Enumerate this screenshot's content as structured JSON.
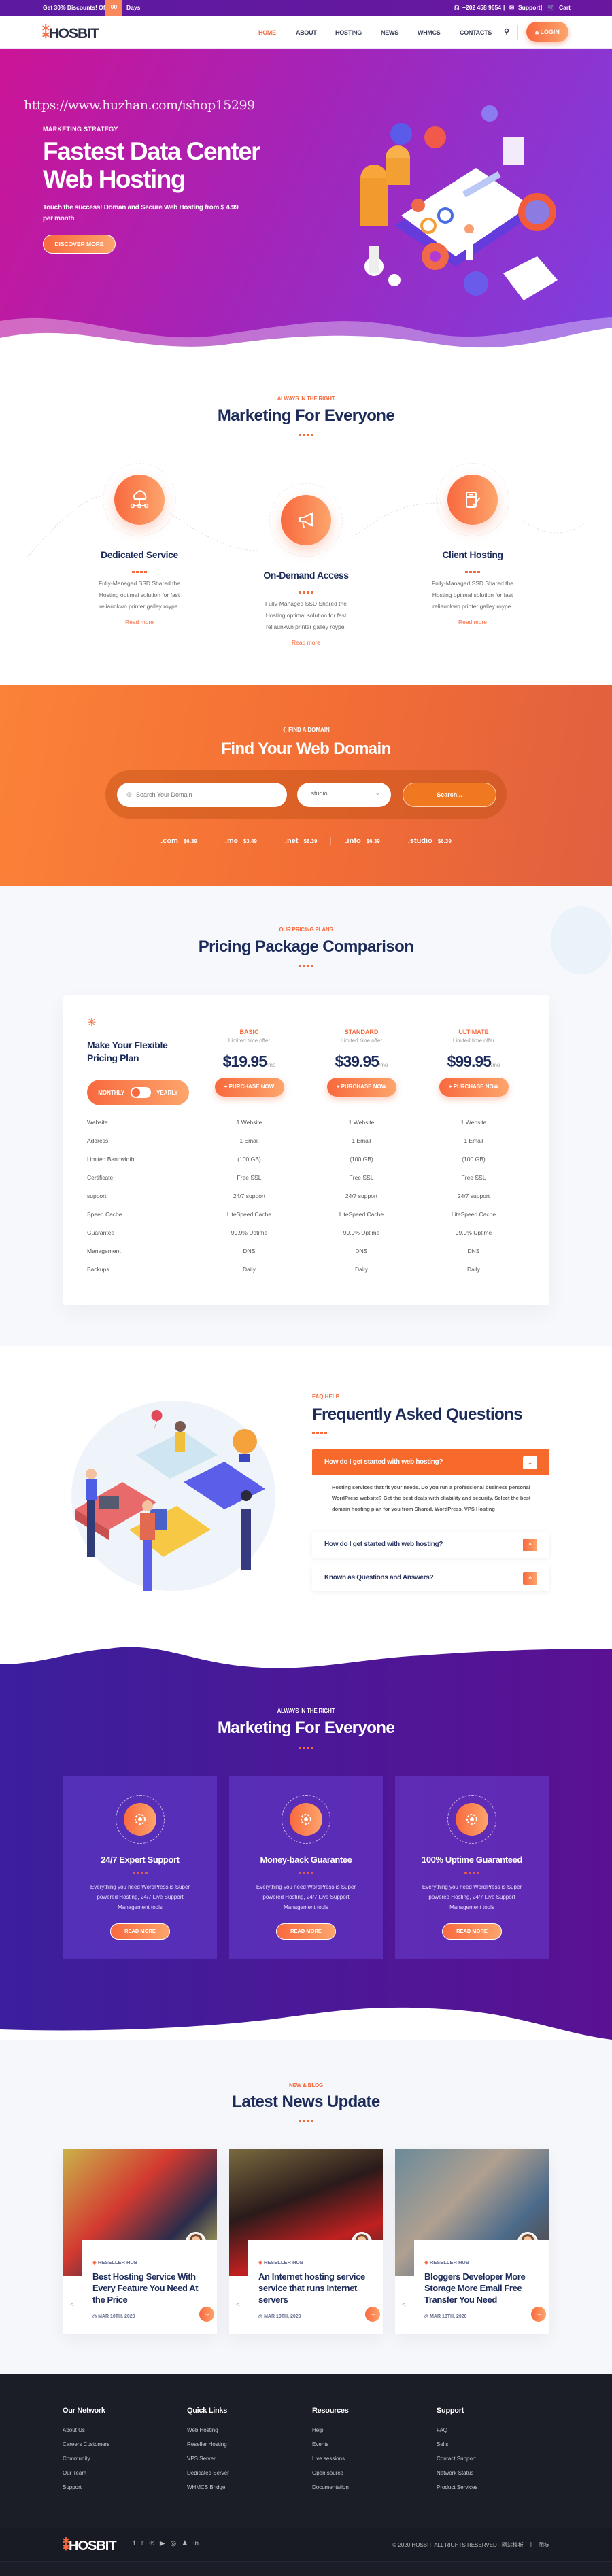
{
  "topbar": {
    "offer": "Get 30% Discounts! Offer",
    "days_count": "00",
    "days_label": "Days",
    "phone": "+202 458 9654",
    "support": "Support",
    "cart": "Cart",
    "separator": "|"
  },
  "header": {
    "logo": "HOSBIT",
    "nav": [
      {
        "label": "HOME",
        "active": true
      },
      {
        "label": "ABOUT"
      },
      {
        "label": "HOSTING"
      },
      {
        "label": "NEWS"
      },
      {
        "label": "WHMCS"
      },
      {
        "label": "CONTACTS"
      }
    ],
    "login": "LOGIN"
  },
  "hero": {
    "watermark": "https://www.huzhan.com/ishop15299",
    "eyebrow": "MARKETING STRATEGY",
    "title_line1": "Fastest Data Center",
    "title_line2": "Web Hosting",
    "subtitle": "Touch the success! Doman and Secure Web Hosting from $ 4.99 per month",
    "cta": "DISCOVER MORE"
  },
  "services": {
    "eyebrow": "ALWAYS IN THE RIGHT",
    "title": "Marketing For Everyone",
    "items": [
      {
        "title": "Dedicated Service",
        "desc": "Fully-Managed SSD Shared the Hosting optimal solution for fast reliaunkwn printer galley roype.",
        "link": "Read more",
        "icon": "cloud-network-icon"
      },
      {
        "title": "On-Demand Access",
        "desc": "Fully-Managed SSD Shared the Hosting optimal solution for fast reliaunkwn printer galley roype.",
        "link": "Read more",
        "icon": "megaphone-icon"
      },
      {
        "title": "Client Hosting",
        "desc": "Fully-Managed SSD Shared the Hosting optimal solution for fast reliaunkwn printer galley roype.",
        "link": "Read more",
        "icon": "server-edit-icon"
      }
    ]
  },
  "domain": {
    "eyebrow": "FIND A DOMAIN",
    "title": "Find Your Web Domain",
    "placeholder": "Search Your Domain",
    "selected_tld": ".studio",
    "search_button": "Search...",
    "tlds": [
      {
        "ext": ".com",
        "price": "$6.39"
      },
      {
        "ext": ".me",
        "price": "$3.49"
      },
      {
        "ext": ".net",
        "price": "$8.39"
      },
      {
        "ext": ".info",
        "price": "$6.39"
      },
      {
        "ext": ".studio",
        "price": "$6.39"
      }
    ]
  },
  "pricing": {
    "eyebrow": "OUR PRICING PLANS",
    "title": "Pricing Package Comparison",
    "intro_line1": "Make Your Flexible",
    "intro_line2": "Pricing Plan",
    "toggle_monthly": "MONTHLY",
    "toggle_yearly": "YEARLY",
    "plans": [
      {
        "name": "BASIC",
        "offer": "Limited time offer",
        "price": "$19.95",
        "per": "/mo",
        "button": "+ PURCHASE NOW"
      },
      {
        "name": "STANDARD",
        "offer": "Limited time offer",
        "price": "$39.95",
        "per": "/mo",
        "button": "+ PURCHASE NOW"
      },
      {
        "name": "ULTIMATE",
        "offer": "Limited time offer",
        "price": "$99.95",
        "per": "/mo",
        "button": "+ PURCHASE NOW"
      }
    ],
    "rows": [
      {
        "label": "Website",
        "values": [
          "1 Website",
          "1 Website",
          "1 Website"
        ]
      },
      {
        "label": "Address",
        "values": [
          "1 Email",
          "1 Email",
          "1 Email"
        ]
      },
      {
        "label": "Limited Bandwidth",
        "values": [
          "(100 GB)",
          "(100 GB)",
          "(100 GB)"
        ]
      },
      {
        "label": "Certificate",
        "values": [
          "Free SSL",
          "Free SSL",
          "Free SSL"
        ]
      },
      {
        "label": "support",
        "values": [
          "24/7 support",
          "24/7 support",
          "24/7 support"
        ]
      },
      {
        "label": "Speed Cache",
        "values": [
          "LiteSpeed Cache",
          "LiteSpeed Cache",
          "LiteSpeed Cache"
        ]
      },
      {
        "label": "Guarantee",
        "values": [
          "99.9% Uptime",
          "99.9% Uptime",
          "99.9% Uptime"
        ]
      },
      {
        "label": "Management",
        "values": [
          "DNS",
          "DNS",
          "DNS"
        ]
      },
      {
        "label": "Backups",
        "values": [
          "Daily",
          "Daily",
          "Daily"
        ]
      }
    ]
  },
  "faq": {
    "eyebrow": "FAQ HELP",
    "title": "Frequently Asked Questions",
    "items": [
      {
        "question": "How do I get started with web hosting?",
        "answer": "Hosting services that fit your needs. Do you run a professional business personal WordPress website? Get the best deals with eliability and security. Select the best domain hosting plan for you from Shared, WordPress, VPS Hosting",
        "open": true
      },
      {
        "question": "How do I get started with web hosting?",
        "open": false
      },
      {
        "question": "Known as Questions and Answers?",
        "open": false
      }
    ]
  },
  "features": {
    "eyebrow": "ALWAYS IN THE RIGHT",
    "title": "Marketing For Everyone",
    "items": [
      {
        "title": "24/7 Expert Support",
        "desc": "Everything you need WordPress is Super powered Hosting, 24/7 Live Support Management tools",
        "button": "READ MORE",
        "icon": "gear-wrench-icon"
      },
      {
        "title": "Money-back Guarantee",
        "desc": "Everything you need WordPress is Super powered Hosting, 24/7 Live Support Management tools",
        "button": "READ MORE",
        "icon": "money-bag-icon"
      },
      {
        "title": "100% Uptime Guaranteed",
        "desc": "Everything you need WordPress is Super powered Hosting, 24/7 Live Support Management tools",
        "button": "READ MORE",
        "icon": "cloud-server-icon"
      }
    ]
  },
  "news": {
    "eyebrow": "NEW & BLOG",
    "title": "Latest News Update",
    "posts": [
      {
        "category": "RESELLER HUB",
        "title": "Best Hosting Service With Every Feature You Need At the Price",
        "date": "MAR 10TH, 2020"
      },
      {
        "category": "RESELLER HUB",
        "title": "An Internet hosting service service that runs Internet servers",
        "date": "MAR 10TH, 2020"
      },
      {
        "category": "RESELLER HUB",
        "title": "Bloggers Developer More Storage More Email Free Transfer You Need",
        "date": "MAR 10TH, 2020"
      }
    ]
  },
  "footer": {
    "columns": [
      {
        "title": "Our Network",
        "links": [
          "About Us",
          "Careers Customers",
          "Community",
          "Our Team",
          "Support"
        ]
      },
      {
        "title": "Quick Links",
        "links": [
          "Web Hosting",
          "Reseller Hosting",
          "VPS Server",
          "Dedicated Server",
          "WHMCS Bridge"
        ]
      },
      {
        "title": "Resources",
        "links": [
          "Help",
          "Events",
          "Live sessions",
          "Open source",
          "Documentation"
        ]
      },
      {
        "title": "Support",
        "links": [
          "FAQ",
          "Sells",
          "Contact Support",
          "Network Status",
          "Product Services"
        ]
      }
    ],
    "logo": "HOSBIT",
    "social": [
      "facebook-icon",
      "twitter-icon",
      "pinterest-icon",
      "youtube-icon",
      "instagram-icon",
      "snapchat-icon",
      "linkedin-icon"
    ],
    "copyright": "© 2020 HOSBIT. ALL RIGHTS RESERVED - 网站模板",
    "separator": "|",
    "extra": "图标"
  },
  "colors": {
    "accent": "#f8693e",
    "accent_light": "#fda56c",
    "navy": "#1c2b5a",
    "topbar": "#5b1aa0",
    "hero_start": "#cc1496",
    "hero_end": "#7d3fe0",
    "footer": "#1b1e27"
  }
}
